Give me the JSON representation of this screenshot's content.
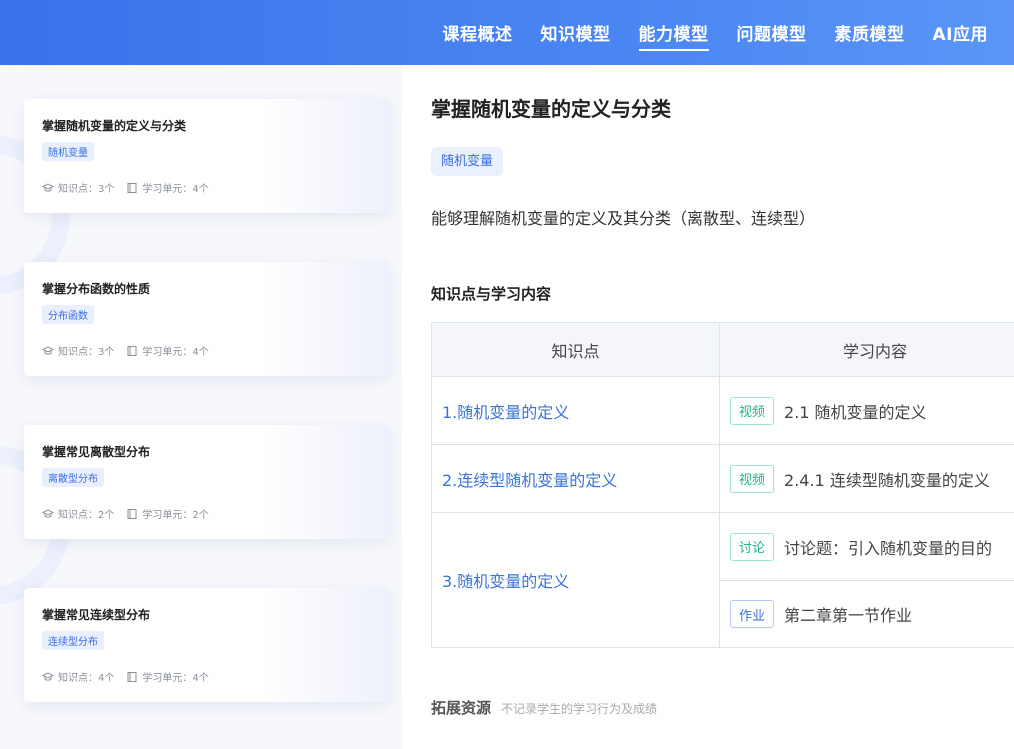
{
  "nav": {
    "items": [
      {
        "label": "课程概述"
      },
      {
        "label": "知识模型"
      },
      {
        "label": "能力模型"
      },
      {
        "label": "问题模型"
      },
      {
        "label": "素质模型"
      },
      {
        "label": "AI应用"
      }
    ],
    "active": "能力模型"
  },
  "cards": [
    {
      "title": "掌握随机变量的定义与分类",
      "tag": "随机变量",
      "knowledge": "知识点：3个",
      "units": "学习单元：4个"
    },
    {
      "title": "掌握分布函数的性质",
      "tag": "分布函数",
      "knowledge": "知识点：3个",
      "units": "学习单元：4个"
    },
    {
      "title": "掌握常见离散型分布",
      "tag": "离散型分布",
      "knowledge": "知识点：2个",
      "units": "学习单元：2个"
    },
    {
      "title": "掌握常见连续型分布",
      "tag": "连续型分布",
      "knowledge": "知识点：4个",
      "units": "学习单元：4个"
    }
  ],
  "detail": {
    "title": "掌握随机变量的定义与分类",
    "tag": "随机变量",
    "description": "能够理解随机变量的定义及其分类（离散型、连续型）",
    "section_title": "知识点与学习内容",
    "table": {
      "headers": [
        "知识点",
        "学习内容"
      ],
      "rows": [
        {
          "point": "1.随机变量的定义",
          "items": [
            {
              "badge": "视频",
              "text": "2.1 随机变量的定义"
            }
          ]
        },
        {
          "point": "2.连续型随机变量的定义",
          "items": [
            {
              "badge": "视频",
              "text": "2.4.1 连续型随机变量的定义"
            }
          ]
        },
        {
          "point": "3.随机变量的定义",
          "items": [
            {
              "badge": "讨论",
              "text": "讨论题：引入随机变量的目的"
            },
            {
              "badge": "作业",
              "text": "第二章第一节作业"
            }
          ]
        }
      ]
    },
    "extension_title": "拓展资源",
    "extension_note": "不记录学生的学习行为及成绩"
  },
  "colors": {
    "header_start": "#3a72ea",
    "header_end": "#5a95f7",
    "link": "#3a74d8",
    "badge_green": "#25b38a",
    "badge_blue": "#3b6ee0"
  },
  "icons": {
    "knowledge": "graduation-cap-icon",
    "units": "book-icon"
  }
}
